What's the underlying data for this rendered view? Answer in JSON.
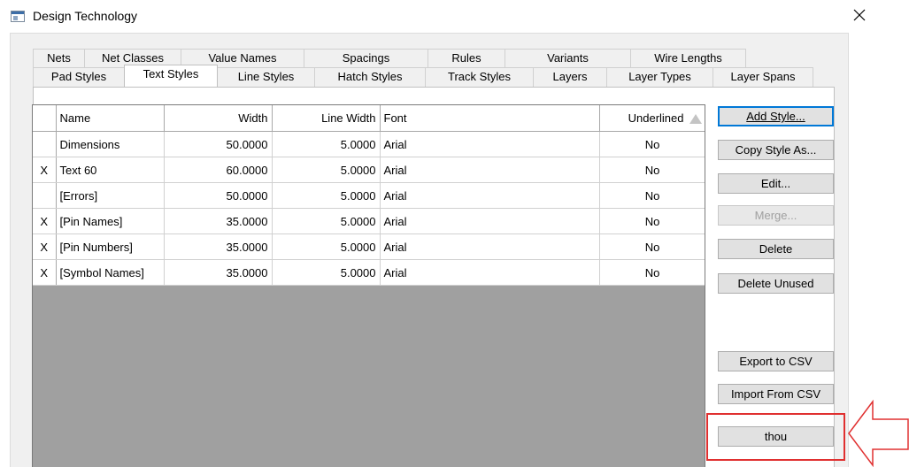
{
  "window": {
    "title": "Design Technology",
    "close_glyph": "×"
  },
  "tabs_row1": [
    "Nets",
    "Net Classes",
    "Value Names",
    "Spacings",
    "Rules",
    "Variants",
    "Wire Lengths"
  ],
  "tabs_row2": [
    "Pad Styles",
    "Text Styles",
    "Line Styles",
    "Hatch Styles",
    "Track Styles",
    "Layers",
    "Layer Types",
    "Layer Spans"
  ],
  "active_tab": "Text Styles",
  "grid": {
    "columns": [
      "",
      "Name",
      "Width",
      "Line Width",
      "Font",
      "Underlined"
    ],
    "rows": [
      {
        "sel": "",
        "name": "Dimensions",
        "width": "50.0000",
        "line_width": "5.0000",
        "font": "Arial",
        "underlined": "No"
      },
      {
        "sel": "X",
        "name": "Text 60",
        "width": "60.0000",
        "line_width": "5.0000",
        "font": "Arial",
        "underlined": "No"
      },
      {
        "sel": "",
        "name": "[Errors]",
        "width": "50.0000",
        "line_width": "5.0000",
        "font": "Arial",
        "underlined": "No"
      },
      {
        "sel": "X",
        "name": "[Pin Names]",
        "width": "35.0000",
        "line_width": "5.0000",
        "font": "Arial",
        "underlined": "No"
      },
      {
        "sel": "X",
        "name": "[Pin Numbers]",
        "width": "35.0000",
        "line_width": "5.0000",
        "font": "Arial",
        "underlined": "No"
      },
      {
        "sel": "X",
        "name": "[Symbol Names]",
        "width": "35.0000",
        "line_width": "5.0000",
        "font": "Arial",
        "underlined": "No"
      }
    ]
  },
  "buttons": {
    "add_style": "Add Style...",
    "copy_style_as": "Copy Style As...",
    "edit": "Edit...",
    "merge": "Merge...",
    "delete": "Delete",
    "delete_unused": "Delete Unused",
    "export_csv": "Export to CSV",
    "import_csv": "Import From CSV",
    "units": "thou"
  },
  "colors": {
    "annotation": "#e03030",
    "accent": "#0078d7"
  }
}
